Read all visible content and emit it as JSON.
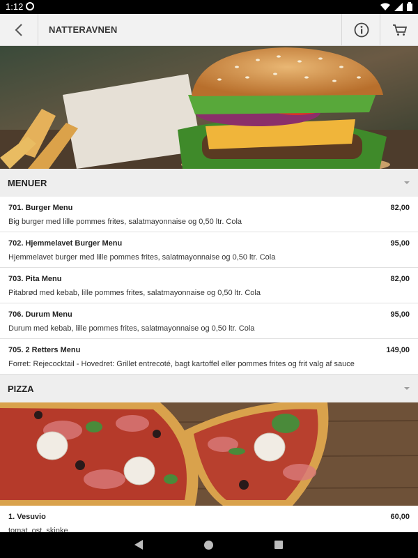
{
  "status_bar": {
    "time": "1:12"
  },
  "toolbar": {
    "title": "NATTERAVNEN"
  },
  "icons": {
    "back": "arrow-left-icon",
    "info": "info-icon",
    "cart": "cart-icon"
  },
  "categories": [
    {
      "title": "MENUER",
      "items": [
        {
          "name": "701. Burger Menu",
          "price": "82,00",
          "desc": "Big burger med lille pommes frites, salatmayonnaise og 0,50 ltr. Cola"
        },
        {
          "name": "702. Hjemmelavet Burger Menu",
          "price": "95,00",
          "desc": "Hjemmelavet burger med lille pommes frites, salatmayonnaise og 0,50 ltr. Cola"
        },
        {
          "name": "703. Pita Menu",
          "price": "82,00",
          "desc": "Pitabrød med kebab, lille pommes frites, salatmayonnaise og 0,50 ltr. Cola"
        },
        {
          "name": "706. Durum Menu",
          "price": "95,00",
          "desc": "Durum med kebab, lille pommes frites, salatmayonnaise og 0,50 ltr. Cola"
        },
        {
          "name": "705. 2 Retters Menu",
          "price": "149,00",
          "desc": "Forret: Rejecocktail - Hovedret: Grillet entrecoté, bagt kartoffel eller pommes frites og frit valg af sauce"
        }
      ]
    },
    {
      "title": "PIZZA",
      "items": [
        {
          "name": "1. Vesuvio",
          "price": "60,00",
          "desc": "tomat, ost, skinke"
        }
      ]
    }
  ],
  "colors": {
    "toolbar_bg": "#f2f2f2",
    "category_bg": "#eeeeee",
    "divider": "#e0e0e0"
  }
}
